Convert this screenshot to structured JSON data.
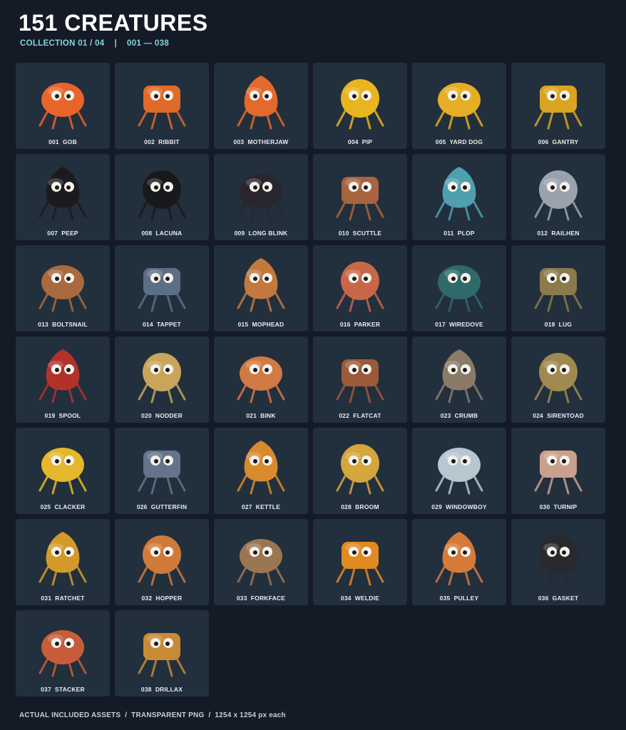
{
  "header": {
    "title": "151 CREATURES",
    "collection": "COLLECTION 01 / 04",
    "separator": "|",
    "range": "001 — 038"
  },
  "creatures": [
    {
      "label": "001  GOB",
      "icon": "orange-spiky-crab-creature-icon",
      "color": "#e8652a"
    },
    {
      "label": "002  RIBBIT",
      "icon": "orange-striped-frog-creature-icon",
      "color": "#e06a28"
    },
    {
      "label": "003  MOTHERJAW",
      "icon": "orange-big-mouth-crab-creature-icon",
      "color": "#e3692d"
    },
    {
      "label": "004  PIP",
      "icon": "yellow-boxy-robot-bug-icon",
      "color": "#e8b420"
    },
    {
      "label": "005  YARD DOG",
      "icon": "yellow-robot-dog-icon",
      "color": "#e6ae24"
    },
    {
      "label": "006  GANTRY",
      "icon": "yellow-arch-robot-icon",
      "color": "#d9a421"
    },
    {
      "label": "007  PEEP",
      "icon": "black-droplet-creature-icon",
      "color": "#1b1b1f"
    },
    {
      "label": "008  LACUNA",
      "icon": "black-ball-dripping-creature-icon",
      "color": "#19191c"
    },
    {
      "label": "009  LONG BLINK",
      "icon": "eyeball-on-stalk-creature-icon",
      "color": "#2a2630"
    },
    {
      "label": "010  SCUTTLE",
      "icon": "rusty-crab-creature-icon",
      "color": "#a8643f"
    },
    {
      "label": "011  PLOP",
      "icon": "teal-blob-creature-icon",
      "color": "#4f9fae"
    },
    {
      "label": "012  RAILHEN",
      "icon": "wading-bird-creature-icon",
      "color": "#9aa3ad"
    },
    {
      "label": "013  BOLTSNAIL",
      "icon": "mechanical-snail-icon",
      "color": "#a86a3e"
    },
    {
      "label": "014  TAPPET",
      "icon": "three-arm-gear-creature-icon",
      "color": "#5d6f86"
    },
    {
      "label": "015  MOPHEAD",
      "icon": "shaggy-hair-creature-icon",
      "color": "#c3783d"
    },
    {
      "label": "016  PARKER",
      "icon": "armored-toad-creature-icon",
      "color": "#c8664a"
    },
    {
      "label": "017  WIREDOVE",
      "icon": "wire-bird-creature-icon",
      "color": "#2f6a6a"
    },
    {
      "label": "018  LUG",
      "icon": "mossy-tortoise-creature-icon",
      "color": "#8a7a4c"
    },
    {
      "label": "019  SPOOL",
      "icon": "red-spool-spider-icon",
      "color": "#b2322a"
    },
    {
      "label": "020  NODDER",
      "icon": "long-neck-creature-icon",
      "color": "#c9a55c"
    },
    {
      "label": "021  BINK",
      "icon": "long-ear-bunny-creature-icon",
      "color": "#d27a43"
    },
    {
      "label": "022  FLATCAT",
      "icon": "skinny-cat-creature-icon",
      "color": "#9c5a3a"
    },
    {
      "label": "023  CRUMB",
      "icon": "rock-pile-creature-icon",
      "color": "#8a7b68"
    },
    {
      "label": "024  SIRENTOAD",
      "icon": "toad-creature-icon",
      "color": "#a0894f"
    },
    {
      "label": "025  CLACKER",
      "icon": "hazard-wing-bug-icon",
      "color": "#e4b82a"
    },
    {
      "label": "026  GUTTERFIN",
      "icon": "catfish-creature-icon",
      "color": "#66738a"
    },
    {
      "label": "027  KETTLE",
      "icon": "kettle-creature-icon",
      "color": "#d98a2c"
    },
    {
      "label": "028  BROOM",
      "icon": "fan-broom-creature-icon",
      "color": "#d4a63b"
    },
    {
      "label": "029  WINDOWBOY",
      "icon": "glass-cross-creature-icon",
      "color": "#b8c6d0"
    },
    {
      "label": "030  TURNIP",
      "icon": "turnip-creature-icon",
      "color": "#c9a08c"
    },
    {
      "label": "031  RATCHET",
      "icon": "ratchet-robot-dog-icon",
      "color": "#d39a2a"
    },
    {
      "label": "032  HOPPER",
      "icon": "box-hopper-robot-icon",
      "color": "#d07a3a"
    },
    {
      "label": "033  FORKFACE",
      "icon": "horned-beast-creature-icon",
      "color": "#9b7652"
    },
    {
      "label": "034  WELDIE",
      "icon": "orb-welder-robot-icon",
      "color": "#e08a22"
    },
    {
      "label": "035  PULLEY",
      "icon": "mushroom-hook-creature-icon",
      "color": "#d67a3a"
    },
    {
      "label": "036  GASKET",
      "icon": "tire-ring-creature-icon",
      "color": "#2a2a2e"
    },
    {
      "label": "037  STACKER",
      "icon": "stacked-box-robot-icon",
      "color": "#c75c3a"
    },
    {
      "label": "038  DRILLAX",
      "icon": "drill-nose-robot-icon",
      "color": "#c98a35"
    }
  ],
  "footer": {
    "assets": "ACTUAL INCLUDED ASSETS",
    "separator": "/",
    "format": "TRANSPARENT PNG",
    "size": "1254 x 1254 px each"
  }
}
